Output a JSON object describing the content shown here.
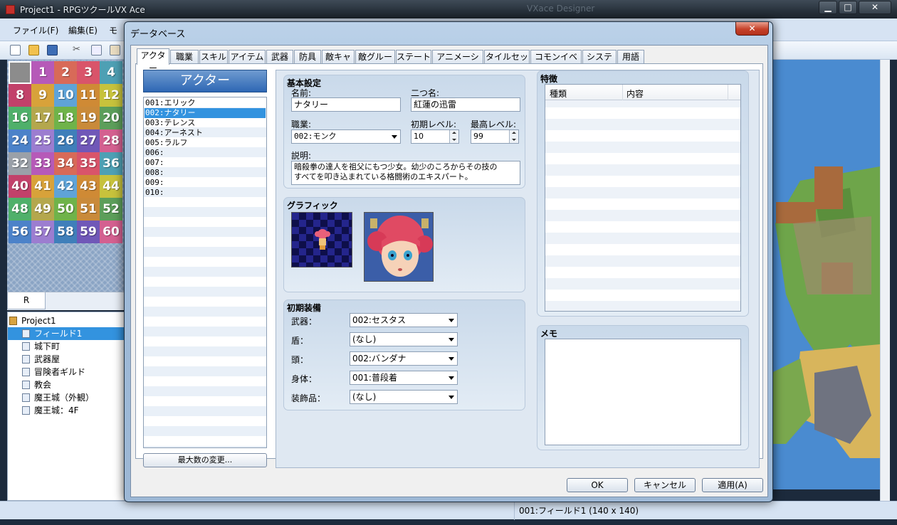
{
  "main_window": {
    "title": "Project1 - RPGツクールVX Ace",
    "ghost_title": "VXace Designer",
    "menu": [
      "ファイル(F)",
      "編集(E)",
      "モ"
    ],
    "controls": {
      "minimize": "▁",
      "maximize": "□",
      "close": "✕"
    }
  },
  "palette": {
    "cells": [
      "",
      "1",
      "2",
      "3",
      "4",
      "8",
      "9",
      "10",
      "11",
      "12",
      "16",
      "17",
      "18",
      "19",
      "20",
      "24",
      "25",
      "26",
      "27",
      "28",
      "32",
      "33",
      "34",
      "35",
      "36",
      "40",
      "41",
      "42",
      "43",
      "44",
      "48",
      "49",
      "50",
      "51",
      "52",
      "56",
      "57",
      "58",
      "59",
      "60"
    ],
    "tab": "R"
  },
  "map_tree": {
    "root": "Project1",
    "maps": [
      "フィールド1",
      "城下町",
      "武器屋",
      "冒険者ギルド",
      "教会",
      "魔王城（外観）",
      "魔王城：4F"
    ],
    "selected_index": 0
  },
  "status_bar": {
    "map_info": "001:フィールド1 (140 x 140)"
  },
  "dialog": {
    "title": "データベース",
    "close": "✕",
    "tabs": [
      "アクター",
      "職業",
      "スキル",
      "アイテム",
      "武器",
      "防具",
      "敵キャラ",
      "敵グループ",
      "ステート",
      "アニメーション",
      "タイルセット",
      "コモンイベント",
      "システム",
      "用語"
    ],
    "active_tab": 0,
    "actor_list": {
      "header": "アクター",
      "items": [
        "001:エリック",
        "002:ナタリー",
        "003:テレンス",
        "004:アーネスト",
        "005:ラルフ",
        "006:",
        "007:",
        "008:",
        "009:",
        "010:"
      ],
      "selected_index": 1,
      "max_button": "最大数の変更..."
    },
    "basic": {
      "title": "基本設定",
      "name_label": "名前:",
      "name": "ナタリー",
      "nickname_label": "二つ名:",
      "nickname": "紅蓮の迅雷",
      "class_label": "職業:",
      "class": "002:モンク",
      "init_level_label": "初期レベル:",
      "init_level": "10",
      "max_level_label": "最高レベル:",
      "max_level": "99",
      "desc_label": "説明:",
      "description": "暗殺拳の達人を祖父にもつ少女。幼少のころからその技の\nすべてを叩き込まれている格闘術のエキスパート。"
    },
    "graphic": {
      "title": "グラフィック"
    },
    "equipment": {
      "title": "初期装備",
      "rows": [
        {
          "label": "武器：",
          "value": "002:セスタス"
        },
        {
          "label": "盾：",
          "value": "(なし)"
        },
        {
          "label": "頭：",
          "value": "002:バンダナ"
        },
        {
          "label": "身体：",
          "value": "001:普段着"
        },
        {
          "label": "装飾品：",
          "value": "(なし)"
        }
      ]
    },
    "features": {
      "title": "特徴",
      "col_type": "種類",
      "col_content": "内容"
    },
    "memo": {
      "title": "メモ"
    },
    "buttons": {
      "ok": "OK",
      "cancel": "キャンセル",
      "apply": "適用(A)"
    }
  }
}
